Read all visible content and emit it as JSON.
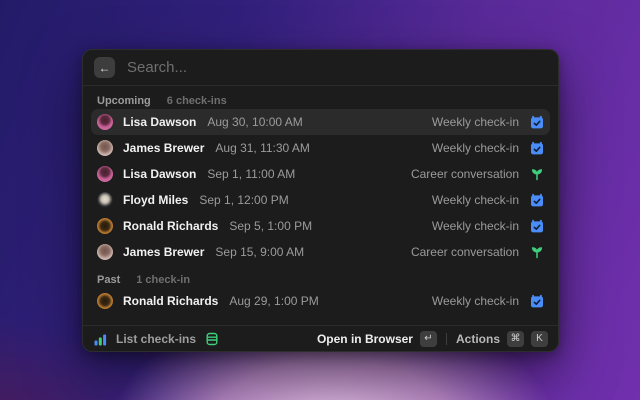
{
  "search": {
    "placeholder": "Search...",
    "back_icon": "←"
  },
  "sections": [
    {
      "label": "Upcoming",
      "count": "6 check-ins",
      "items": [
        {
          "name": "Lisa Dawson",
          "datetime": "Aug 30, 10:00 AM",
          "type": "Weekly check-in",
          "icon": "calendar-check",
          "avatar": "lisa",
          "selected": true
        },
        {
          "name": "James Brewer",
          "datetime": "Aug 31, 11:30 AM",
          "type": "Weekly check-in",
          "icon": "calendar-check",
          "avatar": "james",
          "selected": false
        },
        {
          "name": "Lisa Dawson",
          "datetime": "Sep 1, 11:00 AM",
          "type": "Career conversation",
          "icon": "sprout",
          "avatar": "lisa",
          "selected": false
        },
        {
          "name": "Floyd Miles",
          "datetime": "Sep 1, 12:00 PM",
          "type": "Weekly check-in",
          "icon": "calendar-check",
          "avatar": "floyd",
          "selected": false
        },
        {
          "name": "Ronald Richards",
          "datetime": "Sep 5, 1:00 PM",
          "type": "Weekly check-in",
          "icon": "calendar-check",
          "avatar": "ronald",
          "selected": false
        },
        {
          "name": "James Brewer",
          "datetime": "Sep 15, 9:00 AM",
          "type": "Career conversation",
          "icon": "sprout",
          "avatar": "james",
          "selected": false
        }
      ]
    },
    {
      "label": "Past",
      "count": "1 check-in",
      "items": [
        {
          "name": "Ronald Richards",
          "datetime": "Aug 29, 1:00 PM",
          "type": "Weekly check-in",
          "icon": "calendar-check",
          "avatar": "ronald",
          "selected": false
        }
      ]
    }
  ],
  "footer": {
    "command_label": "List check-ins",
    "open_label": "Open in Browser",
    "open_key": "↵",
    "actions_label": "Actions",
    "action_key_1": "⌘",
    "action_key_2": "K"
  },
  "colors": {
    "accent_blue": "#4a8df8",
    "accent_green": "#3fce7c",
    "window_bg": "#1c1c1c",
    "selected_row_bg": "#2b2b2b"
  }
}
